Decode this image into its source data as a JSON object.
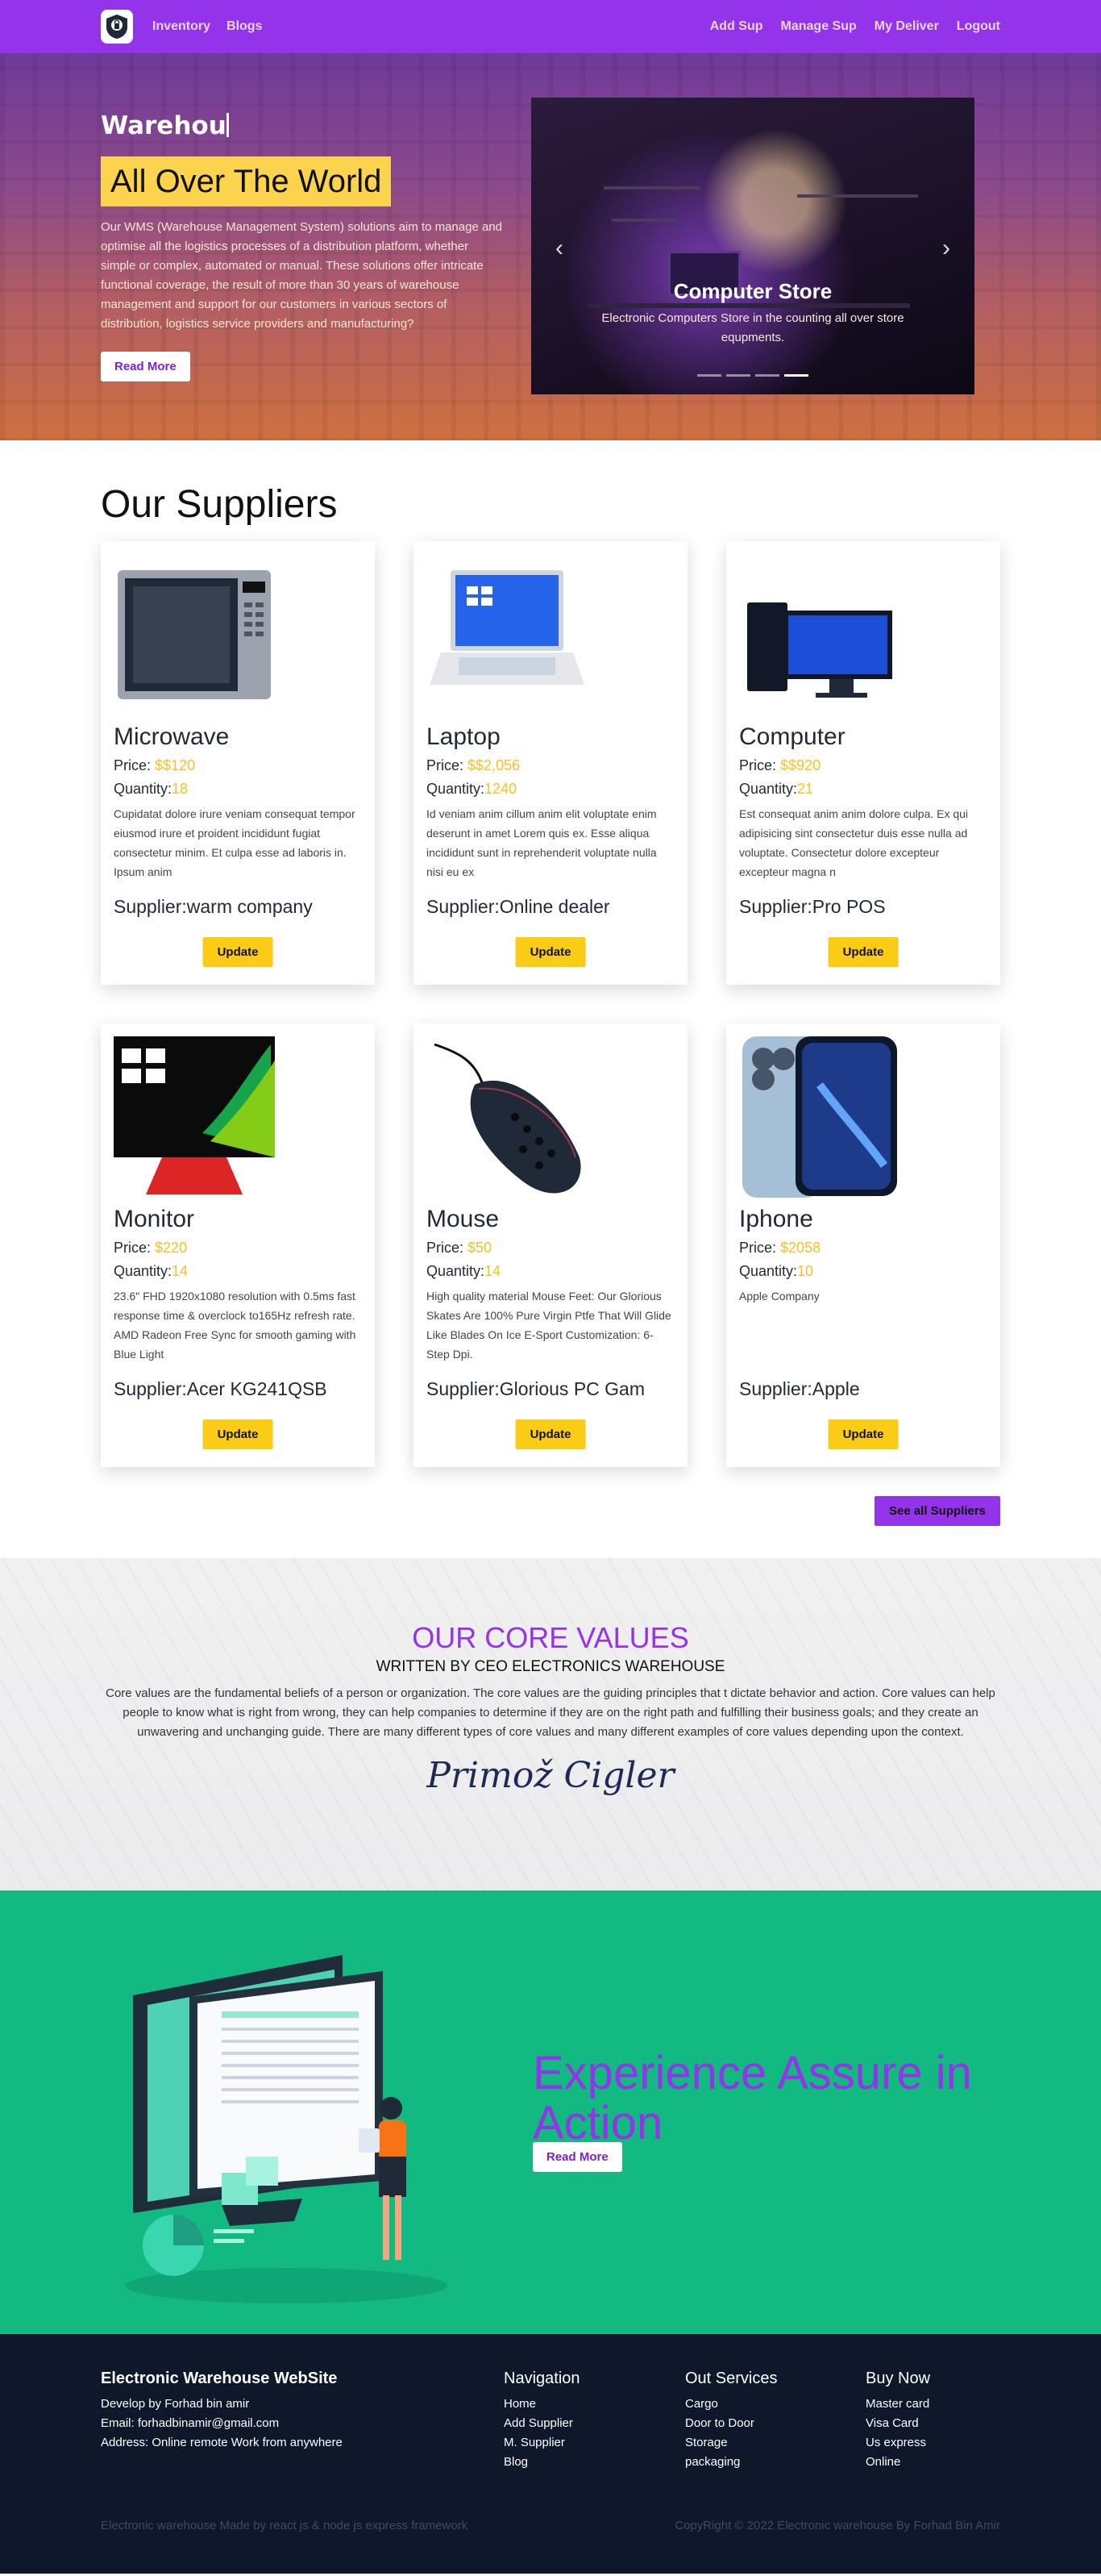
{
  "nav": {
    "left": [
      "Inventory",
      "Blogs"
    ],
    "right": [
      "Add Sup",
      "Manage Sup",
      "My Deliver",
      "Logout"
    ]
  },
  "hero": {
    "typed": "Warehou",
    "tagline": "All Over The World",
    "description": "Our WMS (Warehouse Management System) solutions aim to manage and optimise all the logistics processes of a distribution platform, whether simple or complex, automated or manual. These solutions offer intricate functional coverage, the result of more than 30 years of warehouse management and support for our customers in various sectors of distribution, logistics service providers and manufacturing?",
    "button": "Read More"
  },
  "carousel": {
    "title": "Computer Store",
    "caption": "Electronic Computers Store in the counting all over store equpments.",
    "prev": "‹",
    "next": "›",
    "slide_count": 4,
    "active_slide": 4
  },
  "suppliers": {
    "title": "Our Suppliers",
    "price_label": "Price:",
    "quantity_label": "Quantity:",
    "supplier_label": "Supplier:",
    "update_label": "Update",
    "see_all": "See all Suppliers",
    "items": [
      {
        "name": "Microwave",
        "price": "$$120",
        "quantity": "18",
        "desc": "Cupidatat dolore irure veniam consequat tempor eiusmod irure et proident incididunt fugiat consectetur minim. Et culpa esse ad laboris in. Ipsum anim",
        "supplier": "warm company",
        "image": "microwave"
      },
      {
        "name": "Laptop",
        "price": "$$2,056",
        "quantity": "1240",
        "desc": "Id veniam anim cillum anim elit voluptate enim deserunt in amet Lorem quis ex. Esse aliqua incididunt sunt in reprehenderit voluptate nulla nisi eu ex",
        "supplier": "Online dealer",
        "image": "laptop"
      },
      {
        "name": "Computer",
        "price": "$$920",
        "quantity": "21",
        "desc": "Est consequat anim anim dolore culpa. Ex qui adipisicing sint consectetur duis esse nulla ad voluptate. Consectetur dolore excepteur excepteur magna n",
        "supplier": "Pro POS",
        "image": "computer"
      },
      {
        "name": "Monitor",
        "price": "$220",
        "quantity": "14",
        "desc": "23.6\" FHD 1920x1080 resolution with 0.5ms fast response time & overclock to165Hz refresh rate. AMD Radeon Free Sync for smooth gaming with Blue Light",
        "supplier": "Acer KG241QSB",
        "image": "monitor"
      },
      {
        "name": "Mouse",
        "price": "$50",
        "quantity": "14",
        "desc": "High quality material Mouse Feet: Our Glorious Skates Are 100% Pure Virgin Ptfe That Will Glide Like Blades On Ice E-Sport Customization: 6-Step Dpi.",
        "supplier": "Glorious PC Gam",
        "image": "mouse"
      },
      {
        "name": "Iphone",
        "price": "$2058",
        "quantity": "10",
        "desc": "Apple Company",
        "supplier": "Apple",
        "image": "phone"
      }
    ]
  },
  "core": {
    "title": "OUR CORE VALUES",
    "subtitle": "WRITTEN BY CEO ELECTRONICS WAREHOUSE",
    "body": "Core values are the fundamental beliefs of a person or organization. The core values are the guiding principles that t dictate behavior and action. Core values can help people to know what is right from wrong, they can help companies to determine if they are on the right path and fulfilling their business goals; and they create an unwavering and unchanging guide. There are many different types of core values and many different examples of core values depending upon the context.",
    "signature": "Primož Cigler"
  },
  "experience": {
    "title": "Experience Assure in Action",
    "button": "Read More"
  },
  "footer": {
    "brand": {
      "title": "Electronic Warehouse WebSite",
      "lines": [
        "Develop by Forhad bin amir",
        "Email: forhadbinamir@gmail.com",
        "Address: Online remote Work from anywhere"
      ]
    },
    "navigation": {
      "title": "Navigation",
      "items": [
        "Home",
        "Add Supplier",
        "M. Supplier",
        "Blog"
      ]
    },
    "services": {
      "title": "Out Services",
      "items": [
        "Cargo",
        "Door to Door",
        "Storage",
        "packaging"
      ]
    },
    "buy": {
      "title": "Buy Now",
      "items": [
        "Master card",
        "Visa Card",
        "Us express",
        "Online"
      ]
    },
    "made_by": "Electronic warehouse Made by react js & node js express framework",
    "copyright": "CopyRight © 2022 Electronic warehouse By Forhad Bin Amir"
  },
  "colors": {
    "brand": "#9333ea",
    "accent": "#facc15",
    "green": "#12b981",
    "footer": "#0f172a"
  }
}
